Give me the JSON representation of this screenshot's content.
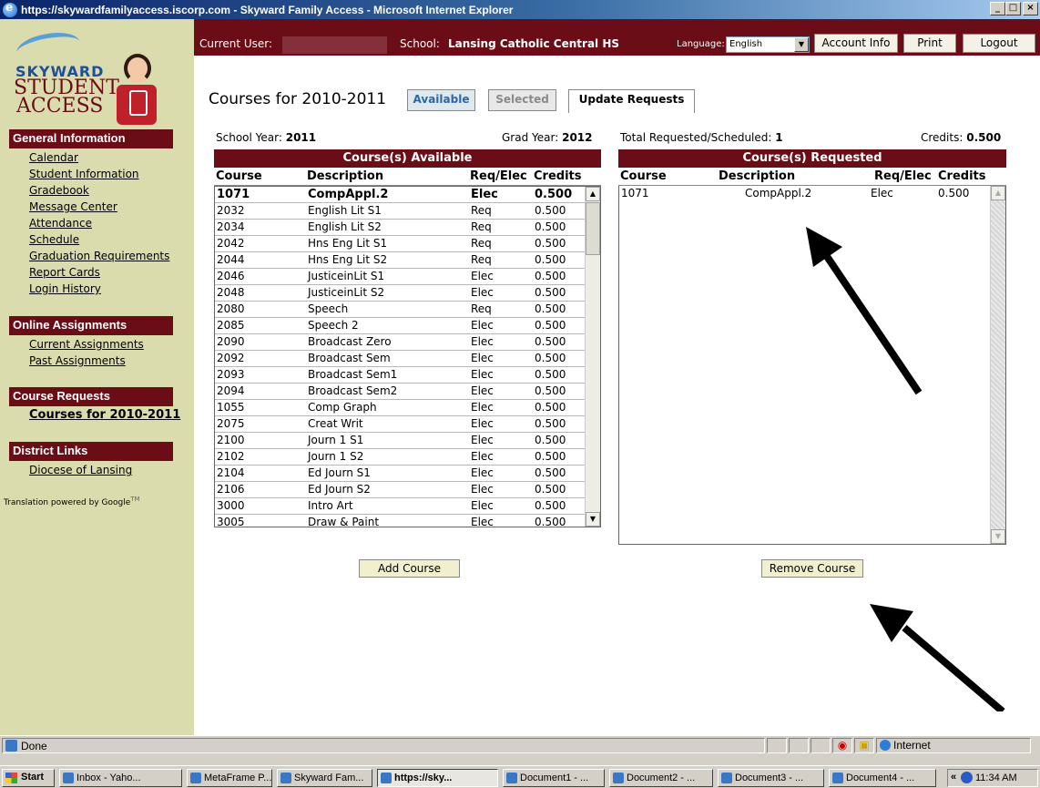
{
  "window": {
    "title": "https://skywardfamilyaccess.iscorp.com - Skyward Family Access - Microsoft Internet Explorer",
    "minimize": "_",
    "maximize": "□",
    "close": "×"
  },
  "logo": {
    "line1": "SKYWARD",
    "line2": "STUDENT",
    "line3": "ACCESS"
  },
  "sidebar": {
    "sections": [
      {
        "title": "General Information",
        "links": [
          "Calendar",
          "Student Information",
          "Gradebook",
          "Message Center",
          "Attendance",
          "Schedule",
          "Graduation Requirements",
          "Report Cards",
          "Login History"
        ]
      },
      {
        "title": "Online Assignments",
        "links": [
          "Current Assignments",
          "Past Assignments"
        ]
      },
      {
        "title": "Course Requests",
        "links": [
          "Courses for 2010-2011"
        ]
      },
      {
        "title": "District Links",
        "links": [
          "Diocese of Lansing"
        ]
      }
    ],
    "translation": "Translation powered by Google",
    "translation_tm": "TM"
  },
  "header": {
    "current_user_label": "Current User:",
    "school_label": "School:",
    "school_name": "Lansing Catholic Central HS",
    "language_label": "Language:",
    "language_value": "English",
    "account_info": "Account Info",
    "print": "Print",
    "logout": "Logout"
  },
  "page": {
    "title": "Courses for 2010-2011",
    "tabs": {
      "available": "Available",
      "selected": "Selected",
      "update": "Update Requests"
    },
    "school_year_label": "School Year:",
    "school_year": "2011",
    "grad_year_label": "Grad Year:",
    "grad_year": "2012",
    "total_label": "Total Requested/Scheduled:",
    "total": "1",
    "credits_label": "Credits:",
    "credits": "0.500"
  },
  "available": {
    "title": "Course(s) Available",
    "columns": {
      "course": "Course",
      "description": "Description",
      "reqelec": "Req/Elec",
      "credits": "Credits"
    },
    "rows": [
      [
        "1071",
        "CompAppl.2",
        "Elec",
        "0.500"
      ],
      [
        "2032",
        "English Lit S1",
        "Req",
        "0.500"
      ],
      [
        "2034",
        "English Lit S2",
        "Req",
        "0.500"
      ],
      [
        "2042",
        "Hns Eng Lit S1",
        "Req",
        "0.500"
      ],
      [
        "2044",
        "Hns Eng Lit S2",
        "Req",
        "0.500"
      ],
      [
        "2046",
        "JusticeinLit S1",
        "Elec",
        "0.500"
      ],
      [
        "2048",
        "JusticeinLit S2",
        "Elec",
        "0.500"
      ],
      [
        "2080",
        "Speech",
        "Req",
        "0.500"
      ],
      [
        "2085",
        "Speech 2",
        "Elec",
        "0.500"
      ],
      [
        "2090",
        "Broadcast Zero",
        "Elec",
        "0.500"
      ],
      [
        "2092",
        "Broadcast Sem",
        "Elec",
        "0.500"
      ],
      [
        "2093",
        "Broadcast Sem1",
        "Elec",
        "0.500"
      ],
      [
        "2094",
        "Broadcast Sem2",
        "Elec",
        "0.500"
      ],
      [
        "1055",
        "Comp Graph",
        "Elec",
        "0.500"
      ],
      [
        "2075",
        "Creat Writ",
        "Elec",
        "0.500"
      ],
      [
        "2100",
        "Journ 1 S1",
        "Elec",
        "0.500"
      ],
      [
        "2102",
        "Journ 1 S2",
        "Elec",
        "0.500"
      ],
      [
        "2104",
        "Ed Journ S1",
        "Elec",
        "0.500"
      ],
      [
        "2106",
        "Ed Journ S2",
        "Elec",
        "0.500"
      ],
      [
        "3000",
        "Intro Art",
        "Elec",
        "0.500"
      ],
      [
        "3005",
        "Draw & Paint",
        "Elec",
        "0.500"
      ]
    ],
    "add_button": "Add Course"
  },
  "requested": {
    "title": "Course(s) Requested",
    "columns": {
      "course": "Course",
      "description": "Description",
      "reqelec": "Req/Elec",
      "credits": "Credits"
    },
    "rows": [
      [
        "1071",
        "CompAppl.2",
        "Elec",
        "0.500"
      ]
    ],
    "remove_button": "Remove Course"
  },
  "statusbar": {
    "status": "Done",
    "zone": "Internet"
  },
  "taskbar": {
    "start": "Start",
    "tasks": [
      "Inbox - Yaho...",
      "MetaFrame P...",
      "Skyward Fam...",
      "https://sky...",
      "Document1 - ...",
      "Document2 - ...",
      "Document3 - ...",
      "Document4 - ..."
    ],
    "time": "11:34 AM"
  }
}
